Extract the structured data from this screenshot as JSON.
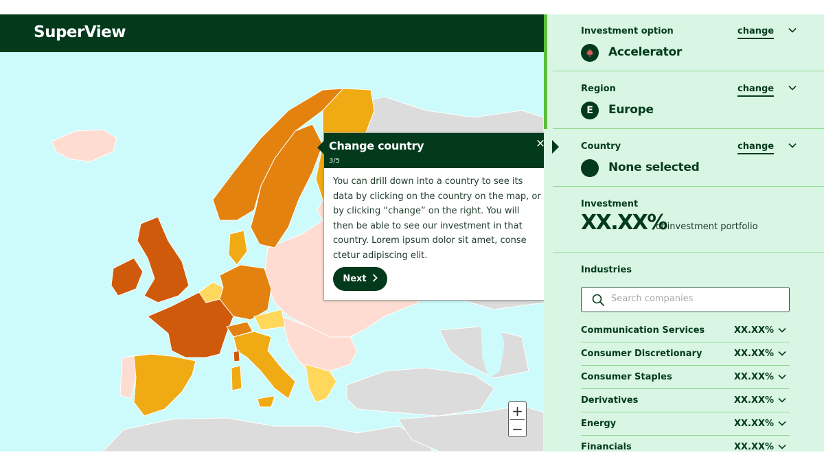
{
  "app": {
    "logo": "SuperView"
  },
  "map": {
    "colors": {
      "sea": "#cdfafa",
      "land_neutral": "#dcdcdc",
      "low": "#ffdcd2",
      "yellow": "#ffd75a",
      "amber": "#f0aa14",
      "orange": "#e3820f",
      "dark_orange": "#cf5a0c"
    },
    "zoom": {
      "in": "+",
      "out": "−"
    }
  },
  "tooltip": {
    "title": "Change country",
    "step": "3/5",
    "body": "You can drill down into a country to see its data by clicking on the country on the map, or by clicking “change” on the right. You will then be able to see our investment in that country. Lorem ipsum dolor sit amet, conse ctetur adipiscing elit.",
    "next_label": "Next",
    "close_icon": "×"
  },
  "panel": {
    "investment_option": {
      "label": "Investment option",
      "change": "change",
      "value": "Accelerator",
      "icon": "maple-leaf-icon"
    },
    "region": {
      "label": "Region",
      "change": "change",
      "value": "Europe",
      "icon_letter": "E"
    },
    "country": {
      "label": "Country",
      "change": "change",
      "value": "None selected"
    },
    "investment": {
      "label": "Investment",
      "value": "XX.XX%",
      "caption": "of investment portfolio"
    },
    "industries": {
      "label": "Industries",
      "search_placeholder": "Search companies",
      "items": [
        {
          "name": "Communication Services",
          "value": "XX.XX%"
        },
        {
          "name": "Consumer Discretionary",
          "value": "XX.XX%"
        },
        {
          "name": "Consumer Staples",
          "value": "XX.XX%"
        },
        {
          "name": "Derivatives",
          "value": "XX.XX%"
        },
        {
          "name": "Energy",
          "value": "XX.XX%"
        },
        {
          "name": "Financials",
          "value": "XX.XX%"
        }
      ]
    },
    "colors": {
      "background": "#d8f6e3",
      "accent": "#5bbf3e",
      "brand": "#033a1c"
    }
  }
}
